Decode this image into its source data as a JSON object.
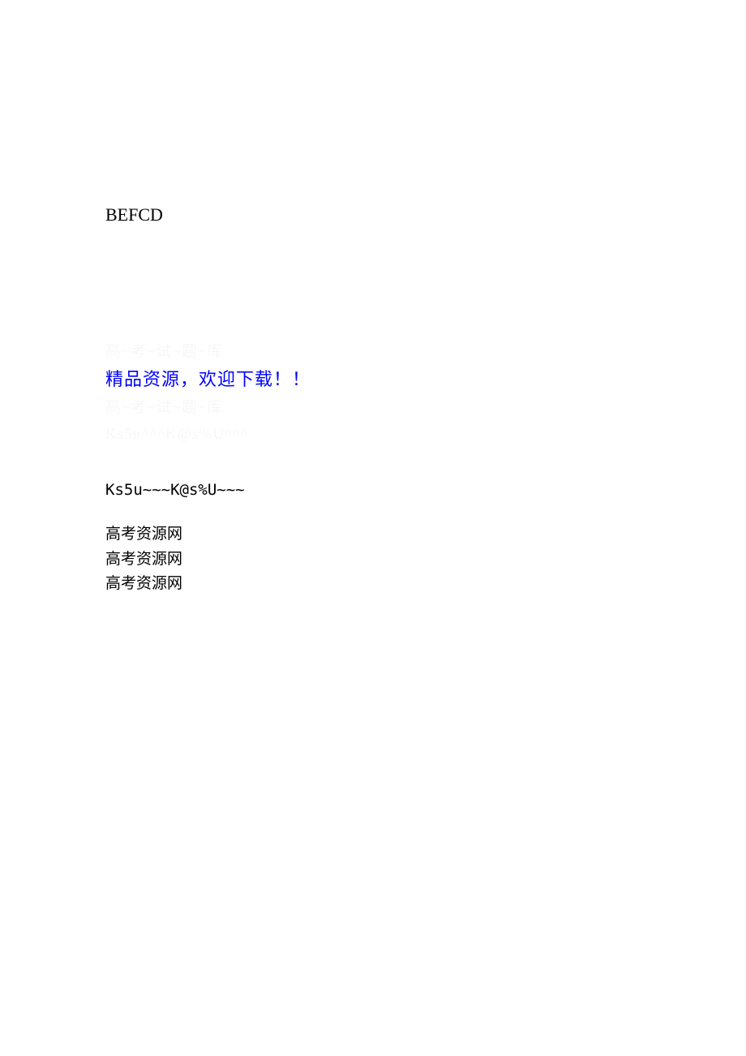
{
  "content": {
    "code_text": "BEFCD",
    "faint_text_1": "高~考~试~题~库",
    "blue_text": "精品资源，欢迎下载！！",
    "faint_text_2": "高~考~试~题~库",
    "faint_text_3": "Ks5u^^^K@s%U^^^",
    "code_string": "Ks5u~~~K@s%U~~~",
    "repeat_1": "高考资源网",
    "repeat_2": "高考资源网",
    "repeat_3": "高考资源网"
  }
}
